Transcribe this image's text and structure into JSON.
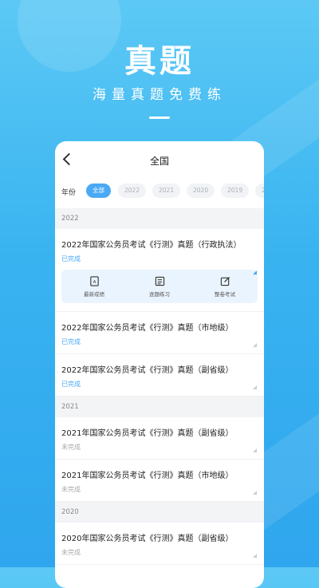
{
  "hero": {
    "title": "真题",
    "subtitle": "海量真题免费练"
  },
  "nav": {
    "title": "全国"
  },
  "filter": {
    "label": "年份",
    "chips": [
      "全部",
      "2022",
      "2021",
      "2020",
      "2019",
      "2"
    ]
  },
  "sections": [
    {
      "year": "2022",
      "items": [
        {
          "title": "2022年国家公务员考试《行测》真题（行政执法）",
          "status": "已完成"
        },
        {
          "title": "2022年国家公务员考试《行测》真题（市地级）",
          "status": "已完成"
        },
        {
          "title": "2022年国家公务员考试《行测》真题（副省级）",
          "status": "已完成"
        }
      ]
    },
    {
      "year": "2021",
      "items": [
        {
          "title": "2021年国家公务员考试《行测》真题（副省级）",
          "status": "未完成"
        },
        {
          "title": "2021年国家公务员考试《行测》真题（市地级）",
          "status": "未完成"
        }
      ]
    },
    {
      "year": "2020",
      "items": [
        {
          "title": "2020年国家公务员考试《行测》真题（副省级）",
          "status": "未完成"
        }
      ]
    }
  ],
  "actions": {
    "latest": "最新成绩",
    "per_question": "逐题练习",
    "full_exam": "整卷考试"
  },
  "colors": {
    "accent": "#4aa9f4",
    "background_top": "#5cc9f5",
    "background_bottom": "#2fa6ee"
  }
}
